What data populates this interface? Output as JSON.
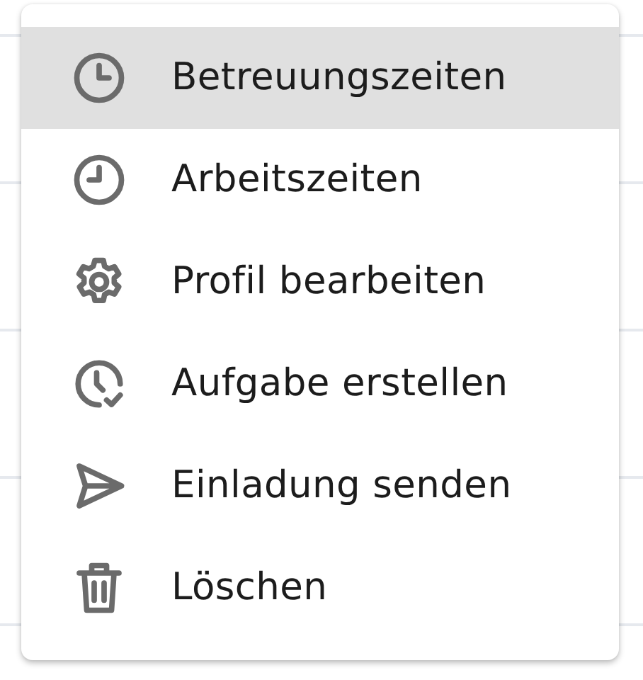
{
  "menu": {
    "items": [
      {
        "label": "Betreuungszeiten",
        "selected": true
      },
      {
        "label": "Arbeitszeiten",
        "selected": false
      },
      {
        "label": "Profil bearbeiten",
        "selected": false
      },
      {
        "label": "Aufgabe erstellen",
        "selected": false
      },
      {
        "label": "Einladung senden",
        "selected": false
      },
      {
        "label": "Löschen",
        "selected": false
      }
    ]
  }
}
